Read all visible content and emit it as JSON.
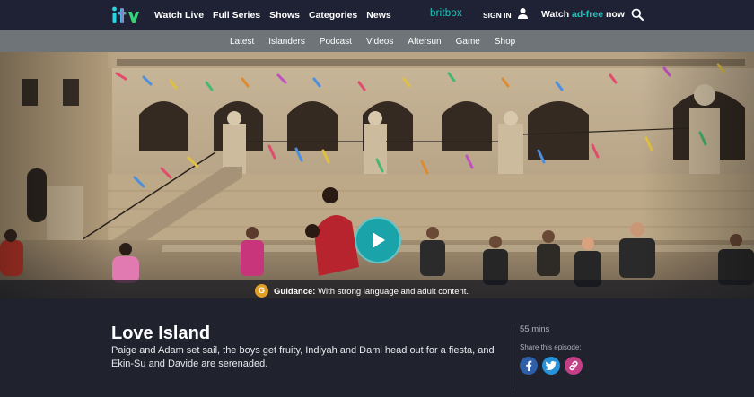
{
  "header": {
    "logo": "itv",
    "nav": [
      "Watch Live",
      "Full Series",
      "Shows",
      "Categories",
      "News"
    ],
    "britbox": "britbox",
    "sign_in": "SIGN IN",
    "watch_prefix": "Watch ",
    "watch_highlight": "ad-free",
    "watch_suffix": " now"
  },
  "subnav": [
    "Latest",
    "Islanders",
    "Podcast",
    "Videos",
    "Aftersun",
    "Game",
    "Shop"
  ],
  "player": {
    "guidance_badge": "G",
    "guidance_label": "Guidance:",
    "guidance_text": " With strong language and adult content."
  },
  "episode": {
    "title": "Love Island",
    "description": "Paige and Adam set sail, the boys get fruity, Indiyah and Dami head out for a fiesta, and Ekin-Su and Davide are serenaded.",
    "duration": "55 mins",
    "share_label": "Share this episode:"
  },
  "colors": {
    "accent": "#1ec7bd",
    "play": "#1aa3a8",
    "guidance": "#e0a028",
    "facebook": "#2f5fa8",
    "twitter": "#2592d9",
    "link": "#c43f86"
  }
}
